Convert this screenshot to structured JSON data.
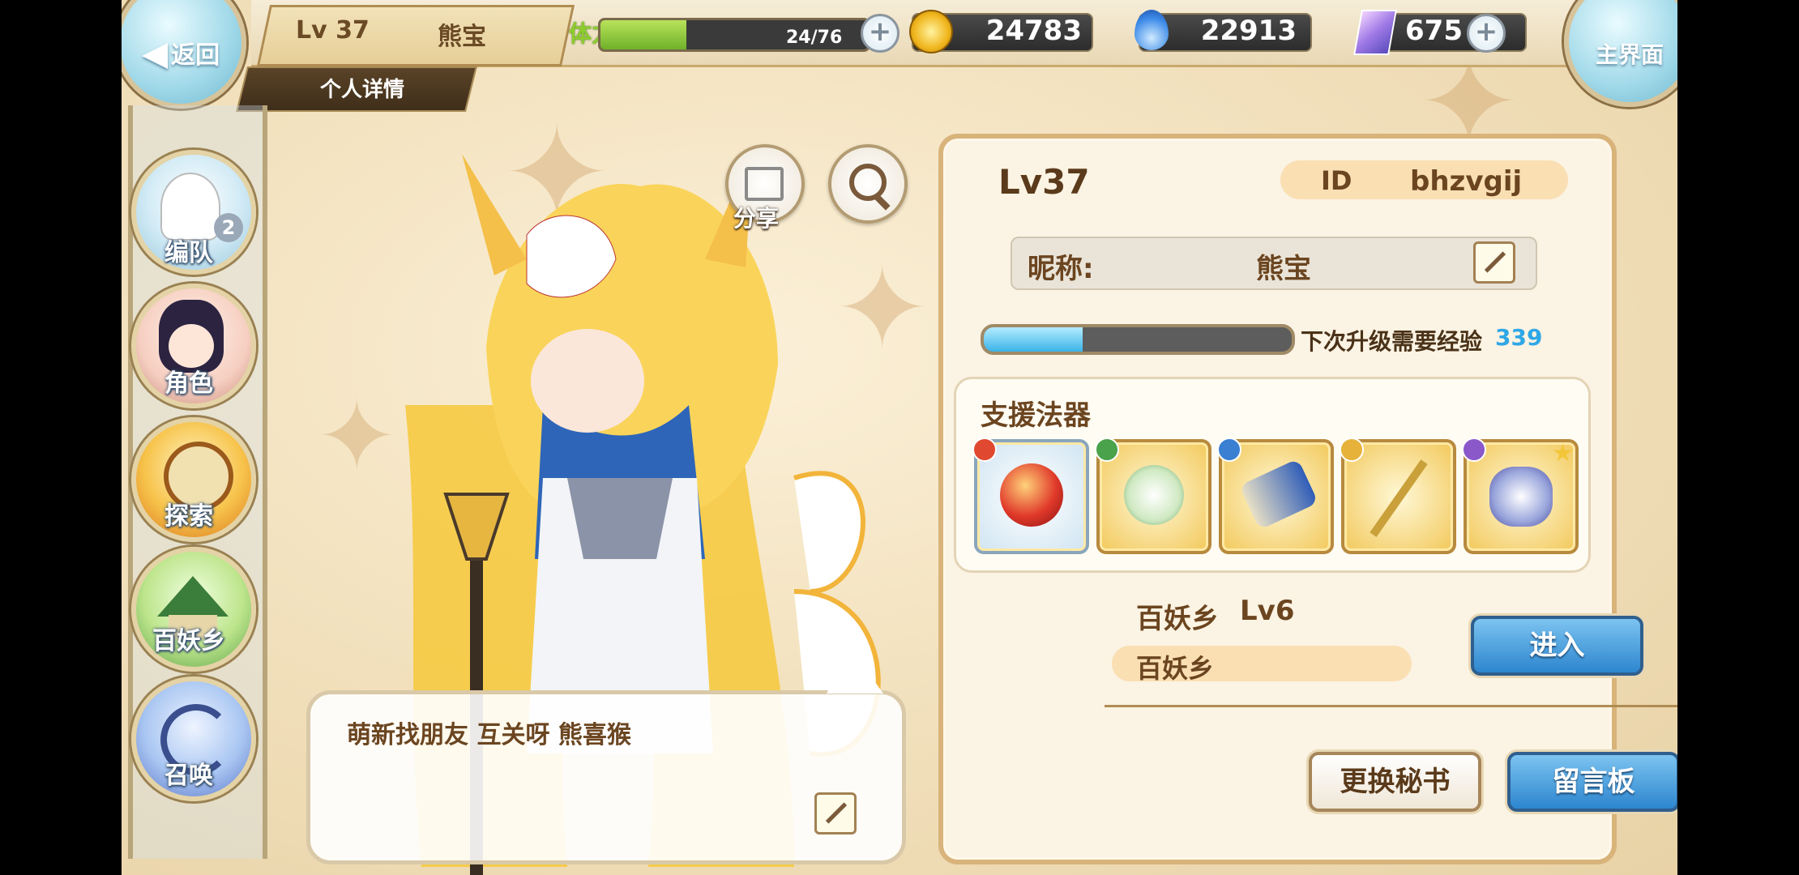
{
  "header": {
    "back_label": "返回",
    "level": "Lv 37",
    "player_name": "熊宝",
    "stamina_label": "体力",
    "stamina_value": "24/76",
    "stamina_fraction": 0.32,
    "gold": "24783",
    "soul": "22913",
    "crystal": "675",
    "home_label": "主界面",
    "detail_tab": "个人详情"
  },
  "nav": {
    "items": [
      {
        "label": "编队",
        "badge": "2"
      },
      {
        "label": "角色"
      },
      {
        "label": "探索"
      },
      {
        "label": "百妖乡"
      },
      {
        "label": "召唤"
      }
    ]
  },
  "actions": {
    "share_label": "分享"
  },
  "message": {
    "text": "萌新找朋友 互关呀 熊喜猴"
  },
  "profile": {
    "level": "Lv37",
    "id_label": "ID",
    "id_value": "bhzvgij",
    "nickname_label": "昵称:",
    "nickname_value": "熊宝",
    "exp_fraction": 0.32,
    "exp_label": "下次升级需要经验",
    "exp_value": "339",
    "support_title": "支援法器",
    "support_items": [
      {
        "element_color": "#e0492f"
      },
      {
        "element_color": "#4aa24a"
      },
      {
        "element_color": "#3a7fd1"
      },
      {
        "element_color": "#e6b23a"
      },
      {
        "element_color": "#8a58c8"
      }
    ],
    "village_name": "百妖乡",
    "village_level": "Lv6",
    "village_field": "百妖乡",
    "enter_label": "进入",
    "change_secretary_label": "更换秘书",
    "message_board_label": "留言板"
  },
  "colors": {
    "accent_blue": "#2d86cf",
    "exp_value": "#2fa7e6",
    "stamina_green": "#8dcc2e"
  }
}
